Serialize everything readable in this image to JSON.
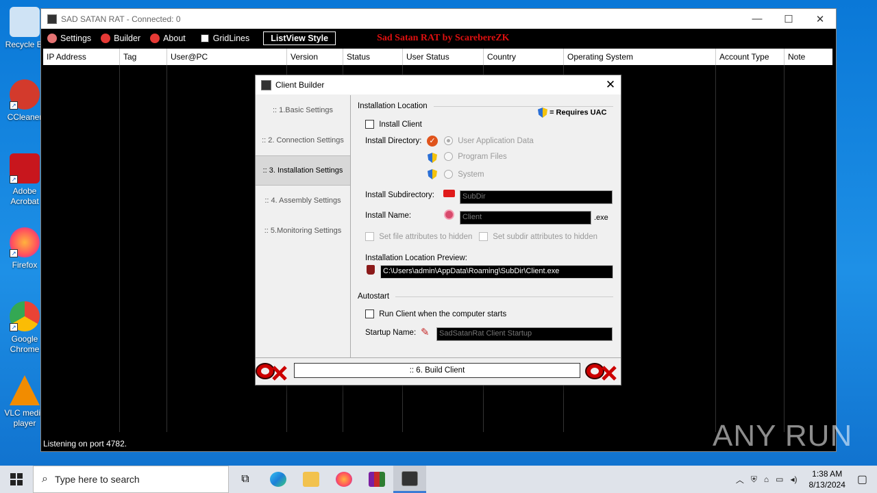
{
  "desktop": {
    "icons": [
      {
        "label": "Recycle Bi",
        "color": "#cfe3f5"
      },
      {
        "label": "CCleaner",
        "color": "#d33a2c"
      },
      {
        "label": "Adobe Acrobat",
        "color": "#c8161d"
      },
      {
        "label": "Firefox",
        "color": "#ff7139"
      },
      {
        "label": "Google Chrome",
        "color": "#4285f4"
      },
      {
        "label": "VLC media player",
        "color": "#f28c00"
      }
    ]
  },
  "main_window": {
    "title": "SAD SATAN RAT - Connected: 0",
    "menu": {
      "settings": "Settings",
      "builder": "Builder",
      "about": "About",
      "gridlines": "GridLines",
      "listview_style": "ListView Style",
      "brand": "Sad Satan RAT by ScarebereZK"
    },
    "columns": [
      "IP Address",
      "Tag",
      "User@PC",
      "Version",
      "Status",
      "User Status",
      "Country",
      "Operating System",
      "Account Type",
      "Note"
    ],
    "status": "Listening on port 4782."
  },
  "dialog": {
    "title": "Client Builder",
    "nav": [
      ":: 1.Basic Settings",
      ":: 2. Connection Settings",
      ":: 3. Installation Settings",
      ":: 4. Assembly Settings",
      ":: 5.Monitoring Settings"
    ],
    "installation": {
      "section": "Installation Location",
      "requires_uac": "= Requires UAC",
      "install_client": "Install Client",
      "install_directory_label": "Install Directory:",
      "dir_options": [
        "User Application Data",
        "Program Files",
        "System"
      ],
      "subdirectory_label": "Install Subdirectory:",
      "subdirectory_value": "SubDir",
      "name_label": "Install Name:",
      "name_value": "Client",
      "ext": ".exe",
      "hide_file": "Set file attributes to hidden",
      "hide_subdir": "Set subdir attributes to hidden",
      "preview_label": "Installation Location Preview:",
      "preview_value": "C:\\Users\\admin\\AppData\\Roaming\\SubDir\\Client.exe"
    },
    "autostart": {
      "section": "Autostart",
      "run_on_start": "Run Client when the computer starts",
      "startup_name_label": "Startup Name:",
      "startup_name_value": "SadSatanRat Client Startup"
    },
    "build_button": ":: 6. Build Client"
  },
  "taskbar": {
    "search_placeholder": "Type here to search",
    "time": "1:38 AM",
    "date": "8/13/2024"
  },
  "watermark": "ANY RUN"
}
